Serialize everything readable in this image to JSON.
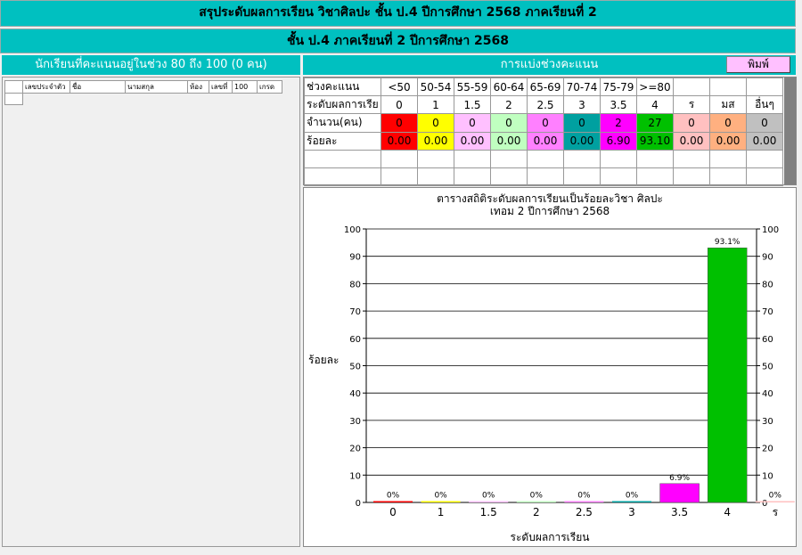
{
  "header": {
    "title": "สรุประดับผลการเรียน วิชาศิลปะ ชั้น ป.4  ปีการศึกษา  2568 ภาคเรียนที่  2",
    "subtitle": "ชั้น ป.4 ภาคเรียนที่  2  ปีการศึกษา  2568"
  },
  "left_panel": {
    "heading": "นักเรียนที่คะแนนอยู่ในช่วง 80 ถึง 100 (0 คน)",
    "columns": [
      "",
      "เลขประจำตัว",
      "ชื่อ",
      "นามสกุล",
      "ห้อง",
      "เลขที่",
      "100",
      "เกรด"
    ]
  },
  "right_panel": {
    "heading": "การแบ่งช่วงคะแนน",
    "print_label": "พิมพ์"
  },
  "grade_table": {
    "row_labels": [
      "ช่วงคะแนน",
      "ระดับผลการเรีย",
      "จำนวน(คน)",
      "ร้อยละ"
    ],
    "ranges": [
      "<50",
      "50-54",
      "55-59",
      "60-64",
      "65-69",
      "70-74",
      "75-79",
      ">=80",
      "",
      "",
      ""
    ],
    "grades": [
      "0",
      "1",
      "1.5",
      "2",
      "2.5",
      "3",
      "3.5",
      "4",
      "ร",
      "มส",
      "อื่นๆ"
    ],
    "counts": [
      "0",
      "0",
      "0",
      "0",
      "0",
      "0",
      "2",
      "27",
      "0",
      "0",
      "0"
    ],
    "percents": [
      "0.00",
      "0.00",
      "0.00",
      "0.00",
      "0.00",
      "0.00",
      "6.90",
      "93.10",
      "0.00",
      "0.00",
      "0.00"
    ],
    "colors": [
      "#ff0000",
      "#ffff00",
      "#ffc0ff",
      "#c0ffc0",
      "#ff80ff",
      "#00a0a0",
      "#ff00ff",
      "#00c000",
      "#ffc0c0",
      "#ffb080",
      "#c0c0c0"
    ]
  },
  "chart_data": {
    "type": "bar",
    "title": "ตารางสถิติระดับผลการเรียนเป็นร้อยละวิชา ศิลปะ",
    "subtitle": "เทอม 2  ปีการศึกษา  2568",
    "xlabel": "ระดับผลการเรียน",
    "ylabel": "ร้อยละ",
    "categories": [
      "0",
      "1",
      "1.5",
      "2",
      "2.5",
      "3",
      "3.5",
      "4",
      "ร"
    ],
    "values": [
      0,
      0,
      0,
      0,
      0,
      0,
      6.9,
      93.1,
      0
    ],
    "labels": [
      "0%",
      "0%",
      "0%",
      "0%",
      "0%",
      "0%",
      "6.9%",
      "93.1%",
      "0%"
    ],
    "colors": [
      "#ff0000",
      "#ffff00",
      "#ffc0ff",
      "#c0ffc0",
      "#ff80ff",
      "#00a0a0",
      "#ff00ff",
      "#00c000",
      "#ffc0c0"
    ],
    "ylim": [
      0,
      100
    ],
    "yticks": [
      0,
      10,
      20,
      30,
      40,
      50,
      60,
      70,
      80,
      90,
      100
    ],
    "grid": true,
    "legend": "none"
  }
}
